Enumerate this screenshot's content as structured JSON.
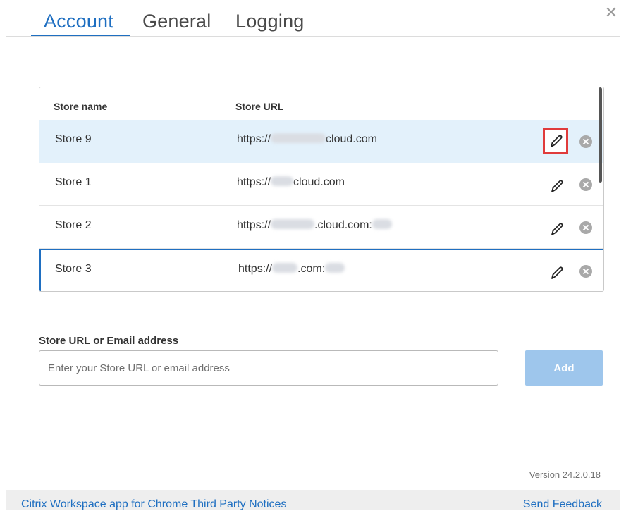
{
  "tabs": {
    "account": "Account",
    "general": "General",
    "logging": "Logging",
    "active": "Account"
  },
  "close_icon": "close-icon",
  "store_table": {
    "headers": {
      "name": "Store name",
      "url": "Store URL"
    },
    "rows": [
      {
        "name": "Store 9",
        "url_prefix": "https://",
        "url_suffix": "cloud.com",
        "selected": true
      },
      {
        "name": "Store 1",
        "url_prefix": "https://",
        "url_suffix": "cloud.com"
      },
      {
        "name": "Store 2",
        "url_prefix": "https://",
        "url_suffix": ".cloud.com:"
      },
      {
        "name": "Store 3",
        "url_prefix": "https://",
        "url_suffix": ".com:"
      }
    ]
  },
  "add_store": {
    "label": "Store URL or Email address",
    "placeholder": "Enter your Store URL or email address",
    "value": "",
    "button": "Add"
  },
  "version": "Version 24.2.0.18",
  "footer": {
    "notices_link": "Citrix Workspace app for Chrome Third Party Notices",
    "feedback_link": "Send Feedback"
  },
  "colors": {
    "accent": "#1f6fc1",
    "selected_row": "#e3f1fb",
    "highlight_border": "#e03b3b",
    "add_button": "#9ec6ec"
  }
}
